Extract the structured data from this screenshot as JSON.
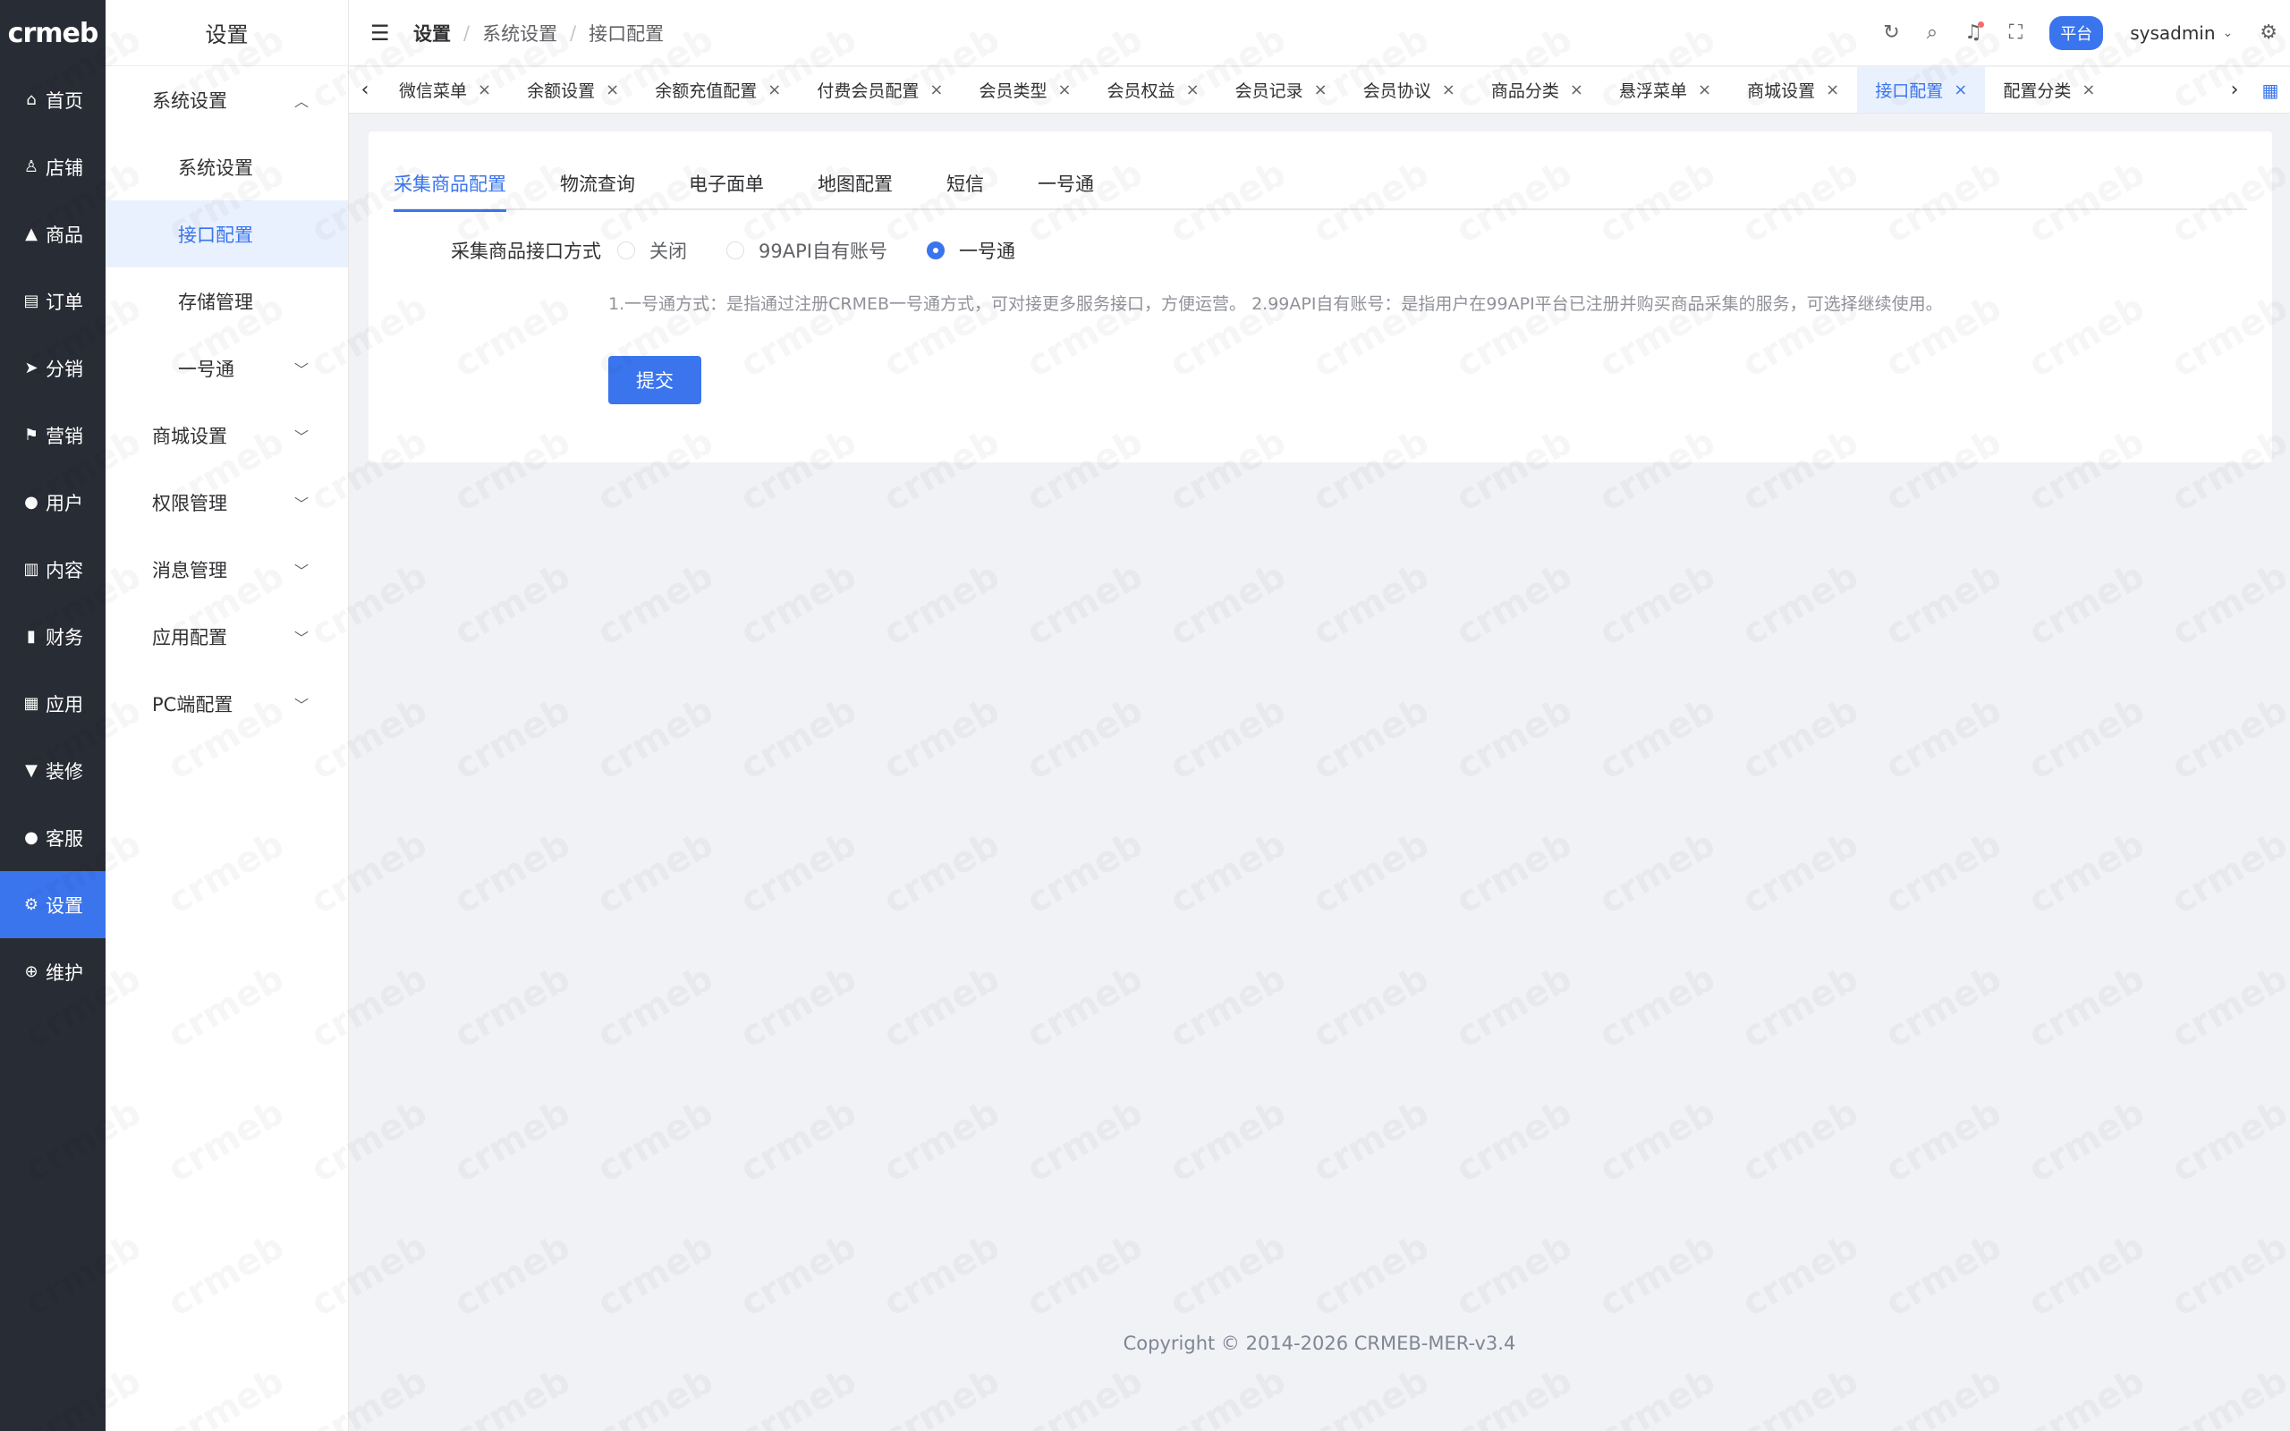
{
  "rail": {
    "logo": "crmeb",
    "items": [
      {
        "label": "首页",
        "icon": "home-icon",
        "glyph": "⌂"
      },
      {
        "label": "店铺",
        "icon": "store-icon",
        "glyph": "♙"
      },
      {
        "label": "商品",
        "icon": "bag-icon",
        "glyph": "▲"
      },
      {
        "label": "订单",
        "icon": "clipboard-icon",
        "glyph": "▤"
      },
      {
        "label": "分销",
        "icon": "send-icon",
        "glyph": "➤"
      },
      {
        "label": "营销",
        "icon": "flag-icon",
        "glyph": "⚑"
      },
      {
        "label": "用户",
        "icon": "user-icon",
        "glyph": "●"
      },
      {
        "label": "内容",
        "icon": "book-icon",
        "glyph": "▥"
      },
      {
        "label": "财务",
        "icon": "bar-chart-icon",
        "glyph": "▮"
      },
      {
        "label": "应用",
        "icon": "grid-icon",
        "glyph": "▦"
      },
      {
        "label": "装修",
        "icon": "brush-icon",
        "glyph": "▼"
      },
      {
        "label": "客服",
        "icon": "service-icon",
        "glyph": "●"
      },
      {
        "label": "设置",
        "icon": "gear-icon",
        "glyph": "⚙",
        "active": true
      },
      {
        "label": "维护",
        "icon": "plus-circle-icon",
        "glyph": "⊕"
      }
    ]
  },
  "submenu": {
    "title": "设置",
    "items": [
      {
        "label": "系统设置",
        "chevron": "up"
      },
      {
        "label": "系统设置",
        "child": true
      },
      {
        "label": "接口配置",
        "child": true,
        "active": true
      },
      {
        "label": "存储管理",
        "child": true
      },
      {
        "label": "一号通",
        "child": true,
        "chevron": "down"
      },
      {
        "label": "商城设置",
        "chevron": "down"
      },
      {
        "label": "权限管理",
        "chevron": "down"
      },
      {
        "label": "消息管理",
        "chevron": "down"
      },
      {
        "label": "应用配置",
        "chevron": "down"
      },
      {
        "label": "PC端配置",
        "chevron": "down"
      }
    ]
  },
  "header": {
    "breadcrumb": [
      "设置",
      "系统设置",
      "接口配置"
    ],
    "platform": "平台",
    "username": "sysadmin"
  },
  "tags": [
    {
      "label": "微信菜单"
    },
    {
      "label": "余额设置"
    },
    {
      "label": "余额充值配置"
    },
    {
      "label": "付费会员配置"
    },
    {
      "label": "会员类型"
    },
    {
      "label": "会员权益"
    },
    {
      "label": "会员记录"
    },
    {
      "label": "会员协议"
    },
    {
      "label": "商品分类"
    },
    {
      "label": "悬浮菜单"
    },
    {
      "label": "商城设置"
    },
    {
      "label": "接口配置",
      "active": true
    },
    {
      "label": "配置分类"
    }
  ],
  "content": {
    "tabs": [
      {
        "label": "采集商品配置",
        "active": true
      },
      {
        "label": "物流查询"
      },
      {
        "label": "电子面单"
      },
      {
        "label": "地图配置"
      },
      {
        "label": "短信"
      },
      {
        "label": "一号通"
      }
    ],
    "form_label": "采集商品接口方式",
    "radios": [
      {
        "label": "关闭",
        "checked": false
      },
      {
        "label": "99API自有账号",
        "checked": false
      },
      {
        "label": "一号通",
        "checked": true
      }
    ],
    "hint": "1.一号通方式：是指通过注册CRMEB一号通方式，可对接更多服务接口，方便运营。 2.99API自有账号：是指用户在99API平台已注册并购买商品采集的服务，可选择继续使用。",
    "submit": "提交"
  },
  "footer": {
    "copyright": "Copyright © 2014-2026 CRMEB-MER-v3.4"
  },
  "colors": {
    "primary": "#3a75ee",
    "rail_bg": "#282c34"
  }
}
